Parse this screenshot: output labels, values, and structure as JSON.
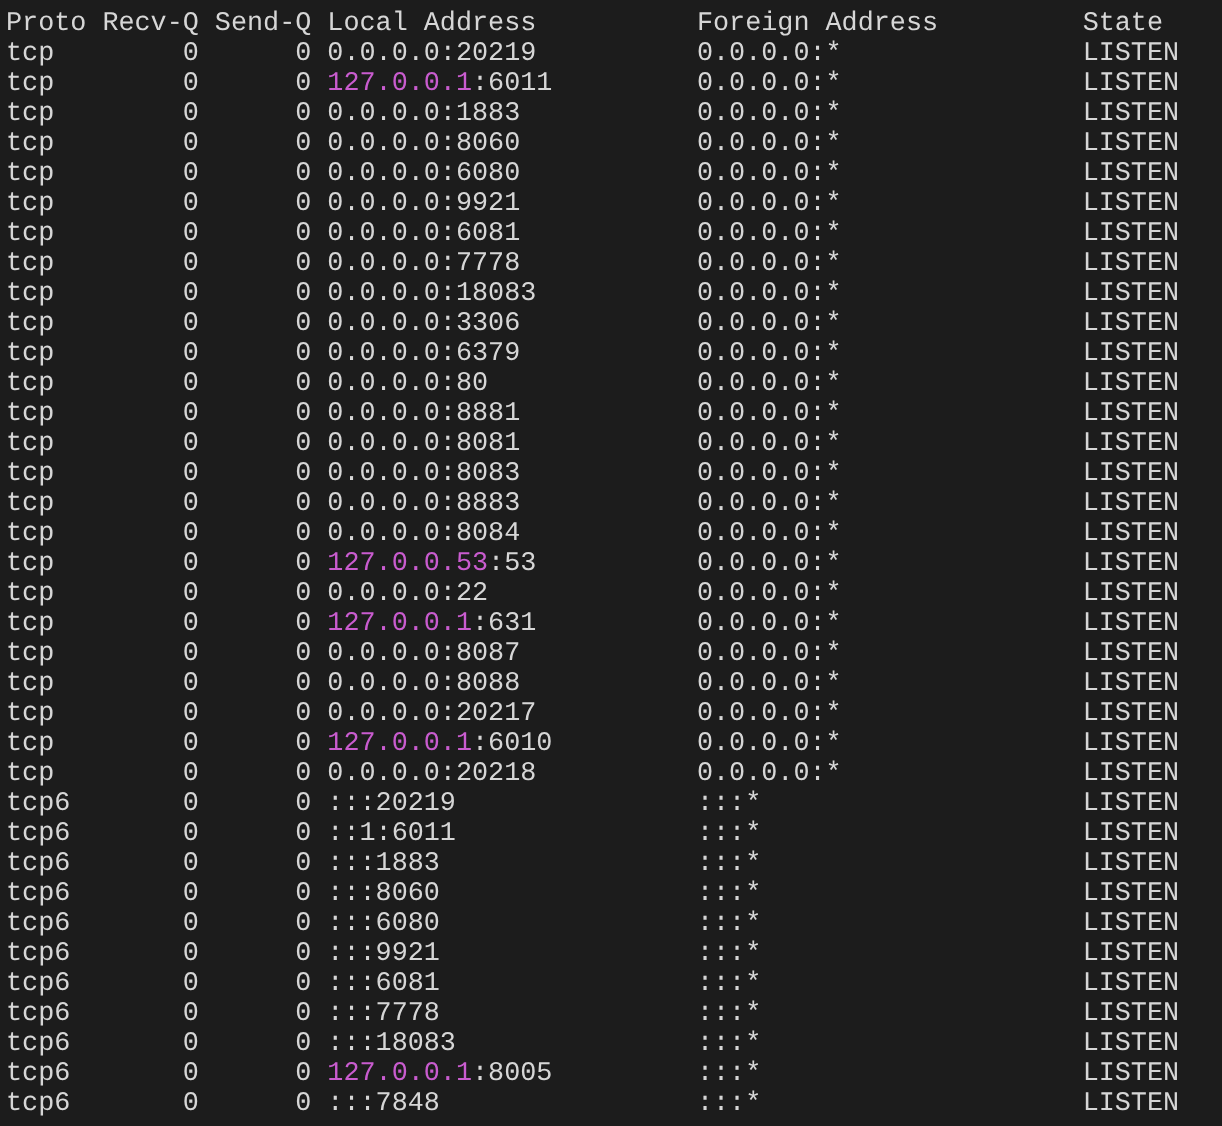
{
  "columns": [
    "Proto",
    "Recv-Q",
    "Send-Q",
    "Local Address",
    "Foreign Address",
    "State"
  ],
  "rows": [
    {
      "proto": "tcp",
      "recv_q": "0",
      "send_q": "0",
      "local": [
        {
          "text": "0.0.0.0:20219",
          "highlight": false
        }
      ],
      "foreign": "0.0.0.0:*",
      "state": "LISTEN"
    },
    {
      "proto": "tcp",
      "recv_q": "0",
      "send_q": "0",
      "local": [
        {
          "text": "127.0.0.1",
          "highlight": true
        },
        {
          "text": ":6011",
          "highlight": false
        }
      ],
      "foreign": "0.0.0.0:*",
      "state": "LISTEN"
    },
    {
      "proto": "tcp",
      "recv_q": "0",
      "send_q": "0",
      "local": [
        {
          "text": "0.0.0.0:1883",
          "highlight": false
        }
      ],
      "foreign": "0.0.0.0:*",
      "state": "LISTEN"
    },
    {
      "proto": "tcp",
      "recv_q": "0",
      "send_q": "0",
      "local": [
        {
          "text": "0.0.0.0:8060",
          "highlight": false
        }
      ],
      "foreign": "0.0.0.0:*",
      "state": "LISTEN"
    },
    {
      "proto": "tcp",
      "recv_q": "0",
      "send_q": "0",
      "local": [
        {
          "text": "0.0.0.0:6080",
          "highlight": false
        }
      ],
      "foreign": "0.0.0.0:*",
      "state": "LISTEN"
    },
    {
      "proto": "tcp",
      "recv_q": "0",
      "send_q": "0",
      "local": [
        {
          "text": "0.0.0.0:9921",
          "highlight": false
        }
      ],
      "foreign": "0.0.0.0:*",
      "state": "LISTEN"
    },
    {
      "proto": "tcp",
      "recv_q": "0",
      "send_q": "0",
      "local": [
        {
          "text": "0.0.0.0:6081",
          "highlight": false
        }
      ],
      "foreign": "0.0.0.0:*",
      "state": "LISTEN"
    },
    {
      "proto": "tcp",
      "recv_q": "0",
      "send_q": "0",
      "local": [
        {
          "text": "0.0.0.0:7778",
          "highlight": false
        }
      ],
      "foreign": "0.0.0.0:*",
      "state": "LISTEN"
    },
    {
      "proto": "tcp",
      "recv_q": "0",
      "send_q": "0",
      "local": [
        {
          "text": "0.0.0.0:18083",
          "highlight": false
        }
      ],
      "foreign": "0.0.0.0:*",
      "state": "LISTEN"
    },
    {
      "proto": "tcp",
      "recv_q": "0",
      "send_q": "0",
      "local": [
        {
          "text": "0.0.0.0:3306",
          "highlight": false
        }
      ],
      "foreign": "0.0.0.0:*",
      "state": "LISTEN"
    },
    {
      "proto": "tcp",
      "recv_q": "0",
      "send_q": "0",
      "local": [
        {
          "text": "0.0.0.0:6379",
          "highlight": false
        }
      ],
      "foreign": "0.0.0.0:*",
      "state": "LISTEN"
    },
    {
      "proto": "tcp",
      "recv_q": "0",
      "send_q": "0",
      "local": [
        {
          "text": "0.0.0.0:80",
          "highlight": false
        }
      ],
      "foreign": "0.0.0.0:*",
      "state": "LISTEN"
    },
    {
      "proto": "tcp",
      "recv_q": "0",
      "send_q": "0",
      "local": [
        {
          "text": "0.0.0.0:8881",
          "highlight": false
        }
      ],
      "foreign": "0.0.0.0:*",
      "state": "LISTEN"
    },
    {
      "proto": "tcp",
      "recv_q": "0",
      "send_q": "0",
      "local": [
        {
          "text": "0.0.0.0:8081",
          "highlight": false
        }
      ],
      "foreign": "0.0.0.0:*",
      "state": "LISTEN"
    },
    {
      "proto": "tcp",
      "recv_q": "0",
      "send_q": "0",
      "local": [
        {
          "text": "0.0.0.0:8083",
          "highlight": false
        }
      ],
      "foreign": "0.0.0.0:*",
      "state": "LISTEN"
    },
    {
      "proto": "tcp",
      "recv_q": "0",
      "send_q": "0",
      "local": [
        {
          "text": "0.0.0.0:8883",
          "highlight": false
        }
      ],
      "foreign": "0.0.0.0:*",
      "state": "LISTEN"
    },
    {
      "proto": "tcp",
      "recv_q": "0",
      "send_q": "0",
      "local": [
        {
          "text": "0.0.0.0:8084",
          "highlight": false
        }
      ],
      "foreign": "0.0.0.0:*",
      "state": "LISTEN"
    },
    {
      "proto": "tcp",
      "recv_q": "0",
      "send_q": "0",
      "local": [
        {
          "text": "127.0.0.53",
          "highlight": true
        },
        {
          "text": ":53",
          "highlight": false
        }
      ],
      "foreign": "0.0.0.0:*",
      "state": "LISTEN"
    },
    {
      "proto": "tcp",
      "recv_q": "0",
      "send_q": "0",
      "local": [
        {
          "text": "0.0.0.0:22",
          "highlight": false
        }
      ],
      "foreign": "0.0.0.0:*",
      "state": "LISTEN"
    },
    {
      "proto": "tcp",
      "recv_q": "0",
      "send_q": "0",
      "local": [
        {
          "text": "127.0.0.1",
          "highlight": true
        },
        {
          "text": ":631",
          "highlight": false
        }
      ],
      "foreign": "0.0.0.0:*",
      "state": "LISTEN"
    },
    {
      "proto": "tcp",
      "recv_q": "0",
      "send_q": "0",
      "local": [
        {
          "text": "0.0.0.0:8087",
          "highlight": false
        }
      ],
      "foreign": "0.0.0.0:*",
      "state": "LISTEN"
    },
    {
      "proto": "tcp",
      "recv_q": "0",
      "send_q": "0",
      "local": [
        {
          "text": "0.0.0.0:8088",
          "highlight": false
        }
      ],
      "foreign": "0.0.0.0:*",
      "state": "LISTEN"
    },
    {
      "proto": "tcp",
      "recv_q": "0",
      "send_q": "0",
      "local": [
        {
          "text": "0.0.0.0:20217",
          "highlight": false
        }
      ],
      "foreign": "0.0.0.0:*",
      "state": "LISTEN"
    },
    {
      "proto": "tcp",
      "recv_q": "0",
      "send_q": "0",
      "local": [
        {
          "text": "127.0.0.1",
          "highlight": true
        },
        {
          "text": ":6010",
          "highlight": false
        }
      ],
      "foreign": "0.0.0.0:*",
      "state": "LISTEN"
    },
    {
      "proto": "tcp",
      "recv_q": "0",
      "send_q": "0",
      "local": [
        {
          "text": "0.0.0.0:20218",
          "highlight": false
        }
      ],
      "foreign": "0.0.0.0:*",
      "state": "LISTEN"
    },
    {
      "proto": "tcp6",
      "recv_q": "0",
      "send_q": "0",
      "local": [
        {
          "text": ":::20219",
          "highlight": false
        }
      ],
      "foreign": ":::*",
      "state": "LISTEN"
    },
    {
      "proto": "tcp6",
      "recv_q": "0",
      "send_q": "0",
      "local": [
        {
          "text": "::1:6011",
          "highlight": false
        }
      ],
      "foreign": ":::*",
      "state": "LISTEN"
    },
    {
      "proto": "tcp6",
      "recv_q": "0",
      "send_q": "0",
      "local": [
        {
          "text": ":::1883",
          "highlight": false
        }
      ],
      "foreign": ":::*",
      "state": "LISTEN"
    },
    {
      "proto": "tcp6",
      "recv_q": "0",
      "send_q": "0",
      "local": [
        {
          "text": ":::8060",
          "highlight": false
        }
      ],
      "foreign": ":::*",
      "state": "LISTEN"
    },
    {
      "proto": "tcp6",
      "recv_q": "0",
      "send_q": "0",
      "local": [
        {
          "text": ":::6080",
          "highlight": false
        }
      ],
      "foreign": ":::*",
      "state": "LISTEN"
    },
    {
      "proto": "tcp6",
      "recv_q": "0",
      "send_q": "0",
      "local": [
        {
          "text": ":::9921",
          "highlight": false
        }
      ],
      "foreign": ":::*",
      "state": "LISTEN"
    },
    {
      "proto": "tcp6",
      "recv_q": "0",
      "send_q": "0",
      "local": [
        {
          "text": ":::6081",
          "highlight": false
        }
      ],
      "foreign": ":::*",
      "state": "LISTEN"
    },
    {
      "proto": "tcp6",
      "recv_q": "0",
      "send_q": "0",
      "local": [
        {
          "text": ":::7778",
          "highlight": false
        }
      ],
      "foreign": ":::*",
      "state": "LISTEN"
    },
    {
      "proto": "tcp6",
      "recv_q": "0",
      "send_q": "0",
      "local": [
        {
          "text": ":::18083",
          "highlight": false
        }
      ],
      "foreign": ":::*",
      "state": "LISTEN"
    },
    {
      "proto": "tcp6",
      "recv_q": "0",
      "send_q": "0",
      "local": [
        {
          "text": "127.0.0.1",
          "highlight": true
        },
        {
          "text": ":8005",
          "highlight": false
        }
      ],
      "foreign": ":::*",
      "state": "LISTEN"
    },
    {
      "proto": "tcp6",
      "recv_q": "0",
      "send_q": "0",
      "local": [
        {
          "text": ":::7848",
          "highlight": false
        }
      ],
      "foreign": ":::*",
      "state": "LISTEN"
    }
  ]
}
